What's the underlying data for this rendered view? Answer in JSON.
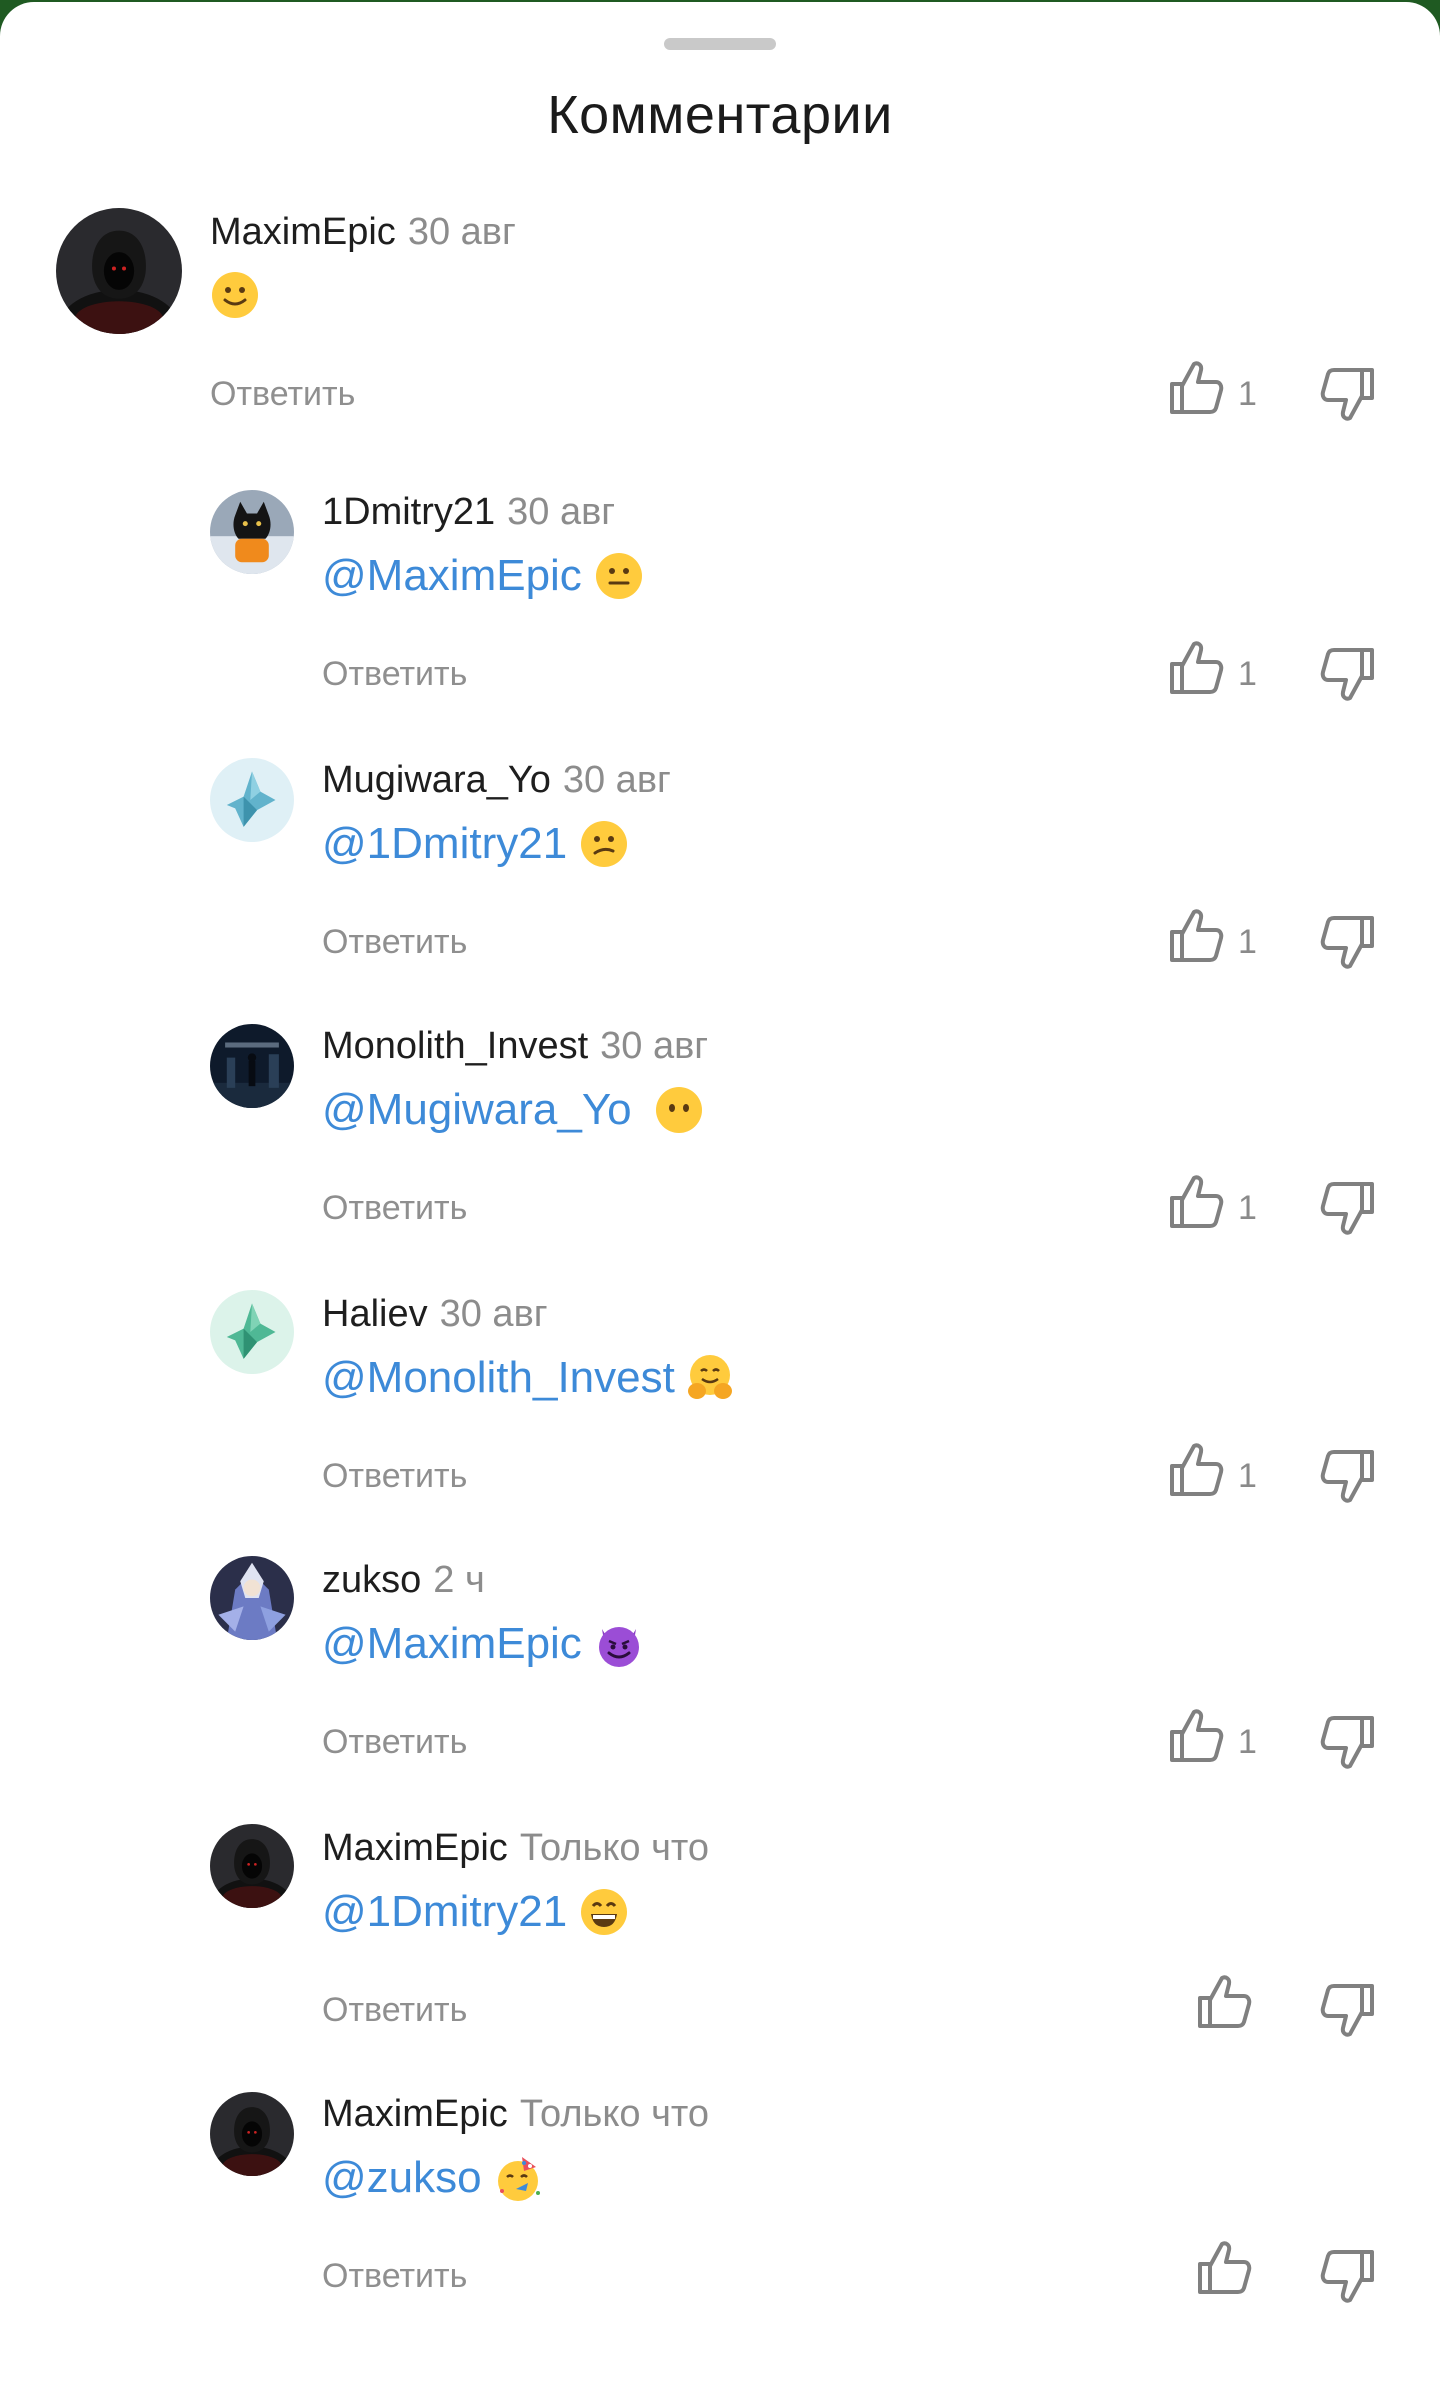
{
  "sheet": {
    "title": "Комментарии"
  },
  "comments": [
    {
      "author": "MaximEpic",
      "time": "30 авг",
      "mention": "",
      "emoji": "slightly-smiling-face",
      "reply": "Ответить",
      "likes": "1",
      "avatar": "hooded-figure-avatar"
    },
    {
      "author": "1Dmitry21",
      "time": "30 авг",
      "mention": "@MaximEpic",
      "emoji": "neutral-face",
      "reply": "Ответить",
      "likes": "1",
      "avatar": "black-cat-avatar"
    },
    {
      "author": "Mugiwara_Yo",
      "time": "30 авг",
      "mention": "@1Dmitry21",
      "emoji": "confused-face",
      "reply": "Ответить",
      "likes": "1",
      "avatar": "blue-fox-avatar"
    },
    {
      "author": "Monolith_Invest",
      "time": "30 авг",
      "mention": "@Mugiwara_Yo",
      "emoji": "face-without-mouth",
      "reply": "Ответить",
      "likes": "1",
      "avatar": "monolith-avatar"
    },
    {
      "author": "Haliev",
      "time": "30 авг",
      "mention": "@Monolith_Invest",
      "emoji": "hugging-face",
      "reply": "Ответить",
      "likes": "1",
      "avatar": "green-fox-avatar"
    },
    {
      "author": "zukso",
      "time": "2 ч",
      "mention": "@MaximEpic",
      "emoji": "smiling-devil",
      "reply": "Ответить",
      "likes": "1",
      "avatar": "anime-character-avatar"
    },
    {
      "author": "MaximEpic",
      "time": "Только что",
      "mention": "@1Dmitry21",
      "emoji": "grinning-face",
      "reply": "Ответить",
      "likes": "",
      "avatar": "hooded-figure-avatar"
    },
    {
      "author": "MaximEpic",
      "time": "Только что",
      "mention": "@zukso",
      "emoji": "partying-face",
      "reply": "Ответить",
      "likes": "",
      "avatar": "hooded-figure-avatar"
    }
  ],
  "icons": {
    "like": "thumbs-up-icon",
    "dislike": "thumbs-down-icon"
  },
  "colors": {
    "accent_mention": "#3d8ad8",
    "secondary_text": "#8f8f8f",
    "top_bar": "#1f5a22"
  }
}
